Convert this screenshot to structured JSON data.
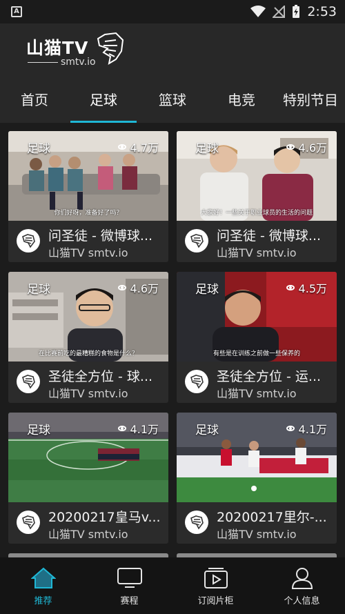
{
  "status_bar": {
    "time": "2:53"
  },
  "header": {
    "logo_text": "山猫TV",
    "logo_sub": "smtv.io"
  },
  "tabs": [
    {
      "label": "首页"
    },
    {
      "label": "足球"
    },
    {
      "label": "篮球"
    },
    {
      "label": "电竞"
    },
    {
      "label": "特别节目"
    }
  ],
  "videos": [
    {
      "tag": "足球",
      "views": "4.7万",
      "caption": "你们好呀，准备好了吗？",
      "title": "问圣徒 - 微博球...",
      "channel": "山猫TV smtv.io"
    },
    {
      "tag": "足球",
      "views": "4.6万",
      "caption": "大家好！一些关于职业球员的生活的问题",
      "title": "问圣徒 - 微博球...",
      "channel": "山猫TV smtv.io"
    },
    {
      "tag": "足球",
      "views": "4.6万",
      "caption": "在比赛前吃的最糟糕的食物是什么？",
      "title": "圣徒全方位 - 球...",
      "channel": "山猫TV smtv.io"
    },
    {
      "tag": "足球",
      "views": "4.5万",
      "caption": "有些是在训练之前做一些保养的",
      "title": "圣徒全方位 - 运...",
      "channel": "山猫TV smtv.io"
    },
    {
      "tag": "足球",
      "views": "4.1万",
      "caption": "",
      "title": "20200217皇马v...",
      "channel": "山猫TV smtv.io"
    },
    {
      "tag": "足球",
      "views": "4.1万",
      "caption": "",
      "title": "20200217里尔-...",
      "channel": "山猫TV smtv.io"
    }
  ],
  "bottom_nav": [
    {
      "label": "推荐",
      "icon": "home-icon"
    },
    {
      "label": "赛程",
      "icon": "monitor-icon"
    },
    {
      "label": "订阅片柜",
      "icon": "play-box-icon"
    },
    {
      "label": "个人信息",
      "icon": "user-icon"
    }
  ],
  "colors": {
    "accent": "#1fb8d6",
    "header_bg": "#282828",
    "page_bg": "#1c1c1c"
  }
}
